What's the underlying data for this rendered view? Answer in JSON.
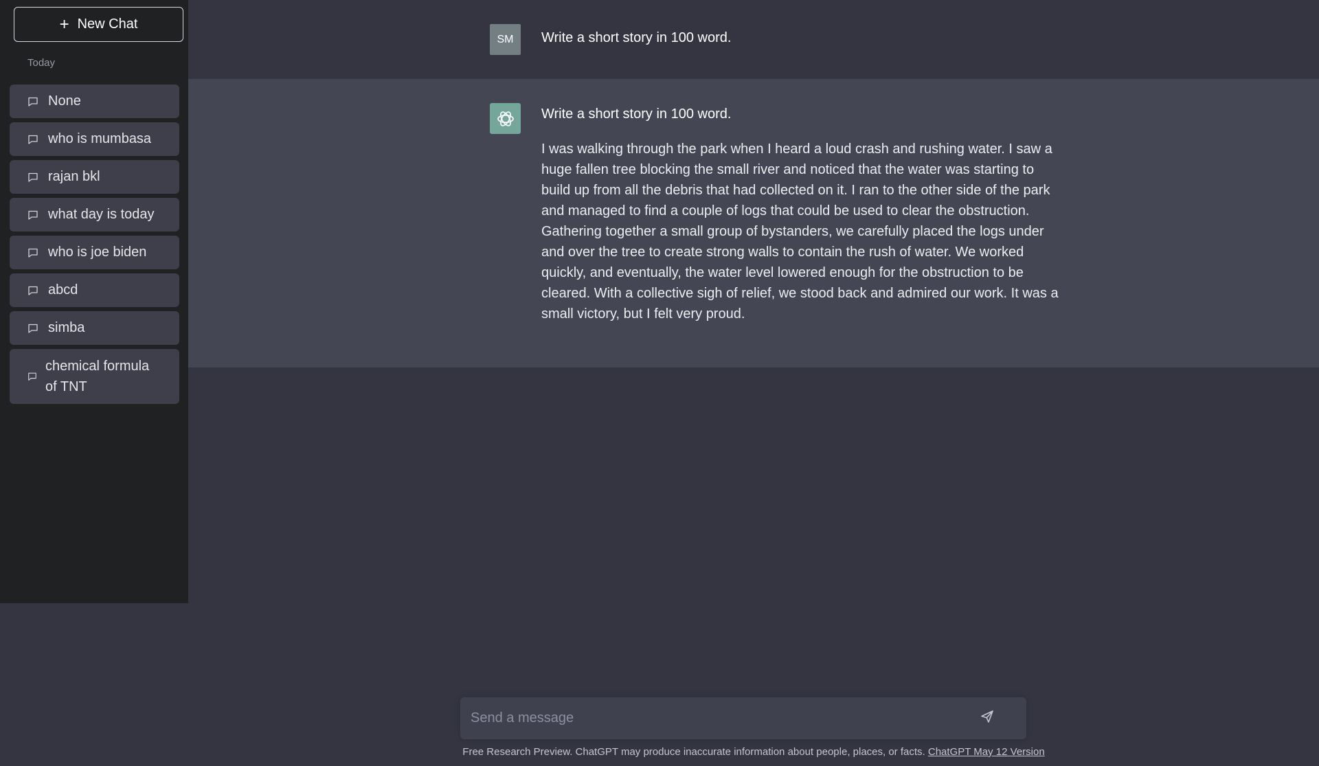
{
  "sidebar": {
    "new_chat_label": "New Chat",
    "section_label": "Today",
    "items": [
      {
        "label": "None"
      },
      {
        "label": "who is mumbasa"
      },
      {
        "label": "rajan bkl"
      },
      {
        "label": "what day is today"
      },
      {
        "label": "who is joe biden"
      },
      {
        "label": "abcd"
      },
      {
        "label": "simba"
      },
      {
        "label": "chemical formula of TNT"
      }
    ]
  },
  "conversation": {
    "user": {
      "avatar_initials": "SM",
      "message": "Write a short story in 100 word."
    },
    "assistant": {
      "avatar_icon": "openai-logo-icon",
      "prompt_echo": "Write a short story in 100 word.",
      "response": "I was walking through the park when I heard a loud crash and rushing water. I saw a huge fallen tree blocking the small river and noticed that the water was starting to build up from all the debris that had collected on it. I ran to the other side of the park and managed to find a couple of logs that could be used to clear the obstruction. Gathering together a small group of bystanders, we carefully placed the logs under and over the tree to create strong walls to contain the rush of water. We worked quickly, and eventually, the water level lowered enough for the obstruction to be cleared. With a collective sigh of relief, we stood back and admired our work. It was a small victory, but I felt very proud."
    }
  },
  "composer": {
    "placeholder": "Send a message",
    "send_icon": "paper-plane-icon"
  },
  "footer": {
    "text": "Free Research Preview. ChatGPT may produce inaccurate information about people, places, or facts.",
    "link_label": "ChatGPT May 12 Version"
  },
  "colors": {
    "sidebar_bg": "#202123",
    "main_bg": "#343541",
    "assistant_bg": "#444654",
    "history_item_bg": "#3e3f4b",
    "user_avatar_bg": "#747f83",
    "assistant_avatar_bg": "#74a79a"
  }
}
